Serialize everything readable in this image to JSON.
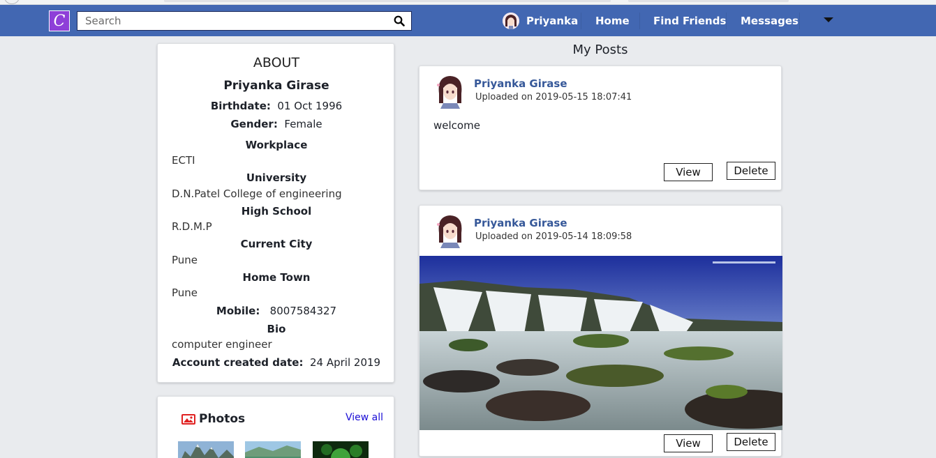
{
  "navbar": {
    "logo_letter": "C",
    "search_placeholder": "Search",
    "user_name": "Priyanka",
    "links": [
      "Home",
      "Find Friends",
      "Messages"
    ]
  },
  "about": {
    "title": "ABOUT",
    "name": "Priyanka Girase",
    "birthdate_label": "Birthdate:",
    "birthdate": "01 Oct 1996",
    "gender_label": "Gender:",
    "gender": "Female",
    "workplace_label": "Workplace",
    "workplace": "ECTI",
    "university_label": "University",
    "university": "D.N.Patel College of engineering",
    "highschool_label": "High School",
    "highschool": "R.D.M.P",
    "city_label": "Current City",
    "city": "Pune",
    "hometown_label": "Home Town",
    "hometown": "Pune",
    "mobile_label": "Mobile:",
    "mobile": "8007584327",
    "bio_label": "Bio",
    "bio": "computer engineer",
    "created_label": "Account created date:",
    "created": "24 April 2019"
  },
  "photos": {
    "title": "Photos",
    "view_all": "View all"
  },
  "posts_heading": "My Posts",
  "posts": [
    {
      "author": "Priyanka Girase",
      "time": "Uploaded on 2019-05-15 18:07:41",
      "text": "welcome",
      "view_label": "View",
      "delete_label": "Delete"
    },
    {
      "author": "Priyanka Girase",
      "time": "Uploaded on 2019-05-14 18:09:58",
      "view_label": "View",
      "delete_label": "Delete"
    }
  ],
  "colors": {
    "navbar": "#4267b2",
    "logo": "#8e3fd8",
    "author_link": "#365899",
    "view_all_link": "#1a0dd6",
    "photos_icon": "#e02020"
  },
  "icons": [
    "app-logo-icon",
    "search-icon",
    "dropdown-caret-icon",
    "photos-icon"
  ]
}
